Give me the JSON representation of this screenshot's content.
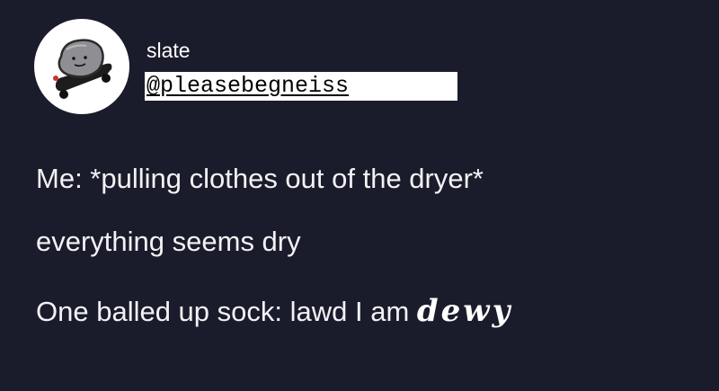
{
  "user": {
    "display_name": "slate",
    "handle": "@pleasebegneiss",
    "avatar_icon": "rock-on-skateboard-avatar"
  },
  "tweet": {
    "line1": "Me: *pulling clothes out of the dryer*",
    "line2": "everything seems dry",
    "line3_prefix": "One balled up sock: lawd I am ",
    "line3_emphasis": "dewy"
  },
  "colors": {
    "background": "#1a1c2b",
    "text": "#ffffff",
    "handle_highlight": "#ffffff"
  }
}
